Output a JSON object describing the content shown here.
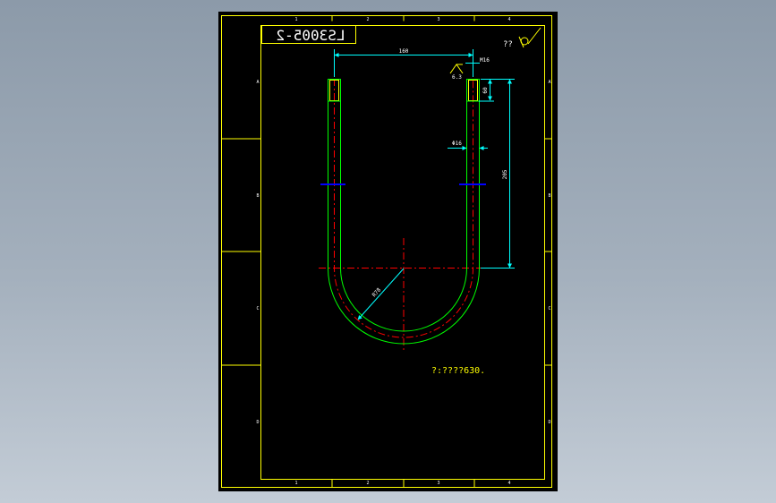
{
  "viewport": {
    "background_gradient": [
      "#8c9aa9",
      "#c3ccd6"
    ],
    "sheet_color": "#000000"
  },
  "drawing": {
    "title_block_text": "LS3005-2",
    "title_block_mirrored": true,
    "roughness_note": "??",
    "surface_symbol_label": "6.3",
    "column_markers": [
      "1",
      "2",
      "3",
      "4"
    ],
    "row_markers": [
      "A",
      "B",
      "C",
      "D"
    ],
    "bottom_note": "?:????630.",
    "dimensions": {
      "width": "160",
      "thread_top": "M16",
      "thread_length": "60",
      "leg_length": "205",
      "rod_diameter": "Φ16",
      "bend_radius": "R78"
    },
    "colors": {
      "border": "#ffff00",
      "rod": "#00ff00",
      "centerline": "#ff0000",
      "dimension": "#00ffff",
      "nut": "#0000ff",
      "text": "#ffffff",
      "note": "#ffff00"
    }
  }
}
